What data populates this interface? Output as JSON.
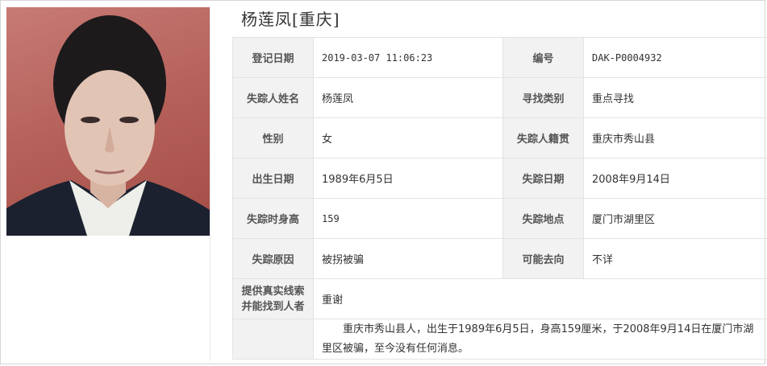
{
  "person": {
    "name_title": "杨莲凤[重庆]"
  },
  "record": {
    "reg_date_label": "登记日期",
    "reg_date": "2019-03-07 11:06:23",
    "id_label": "编号",
    "id": "DAK-P0004932",
    "name_label": "失踪人姓名",
    "name": "杨莲凤",
    "search_type_label": "寻找类别",
    "search_type": "重点寻找",
    "gender_label": "性别",
    "gender": "女",
    "native_label": "失踪人籍贯",
    "native": "重庆市秀山县",
    "birth_label": "出生日期",
    "birth": "1989年6月5日",
    "missing_date_label": "失踪日期",
    "missing_date": "2008年9月14日",
    "height_label": "失踪时身高",
    "height": "159",
    "place_label": "失踪地点",
    "place": "厦门市湖里区",
    "reason_label": "失踪原因",
    "reason": "被拐被骗",
    "dest_label": "可能去向",
    "dest": "不详",
    "reward_label": "提供真实线索并能找到人者",
    "reward": "重谢",
    "description": "重庆市秀山县人，出生于1989年6月5日，身高159厘米，于2008年9月14日在厦门市湖里区被骗，至今没有任何消息。"
  },
  "colors": {
    "label_bg": "#f2f2f2",
    "border": "#e3e3e3",
    "photo_bg": "#b35e57"
  }
}
